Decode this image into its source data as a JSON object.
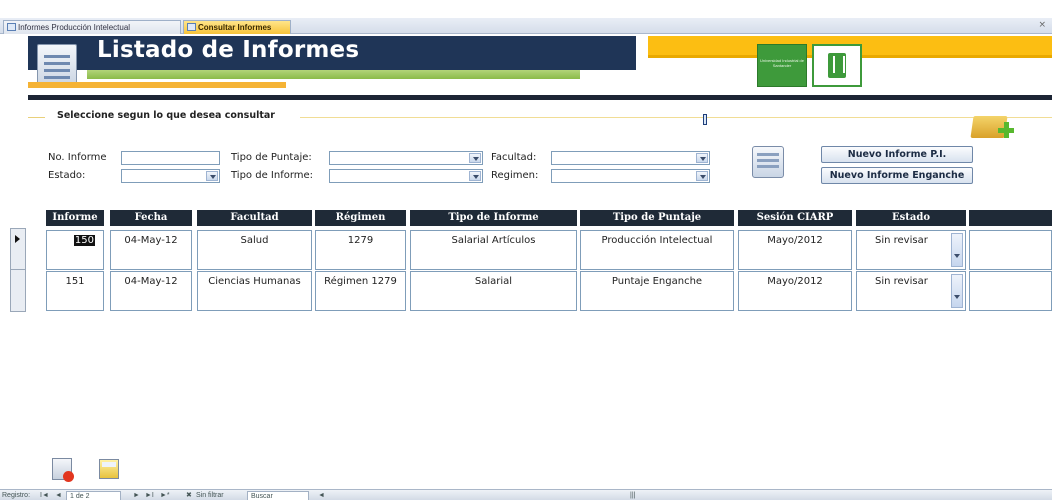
{
  "tabs": [
    {
      "label": "Informes Producción Intelectual"
    },
    {
      "label": "Consultar Informes"
    }
  ],
  "tab_close": "×",
  "header": {
    "title": "Listado de Informes",
    "logo_text": "Universidad Industrial de Santander"
  },
  "section_label": "Seleccione segun lo que desea consultar",
  "filters": {
    "no_informe": {
      "label": "No. Informe",
      "value": ""
    },
    "estado": {
      "label": "Estado:",
      "value": ""
    },
    "tipo_puntaje": {
      "label": "Tipo de Puntaje:",
      "value": ""
    },
    "tipo_informe": {
      "label": "Tipo de Informe:",
      "value": ""
    },
    "facultad": {
      "label": "Facultad:",
      "value": ""
    },
    "regimen": {
      "label": "Regimen:",
      "value": ""
    }
  },
  "buttons": {
    "nuevo_pi": "Nuevo Informe P.I.",
    "nuevo_enganche": "Nuevo Informe Enganche"
  },
  "grid": {
    "columns": [
      "Informe",
      "Fecha",
      "Facultad",
      "Régimen",
      "Tipo de Informe",
      "Tipo de Puntaje",
      "Sesión CIARP",
      "Estado"
    ],
    "rows": [
      {
        "informe": "150",
        "fecha": "04-May-12",
        "facultad": "Salud",
        "regimen": "1279",
        "tipo_informe": "Salarial Artículos",
        "tipo_puntaje": "Producción Intelectual",
        "sesion": "Mayo/2012",
        "estado": "Sin revisar"
      },
      {
        "informe": "151",
        "fecha": "04-May-12",
        "facultad": "Ciencias Humanas",
        "regimen": "Régimen 1279",
        "tipo_informe": "Salarial",
        "tipo_puntaje": "Puntaje Enganche",
        "sesion": "Mayo/2012",
        "estado": "Sin revisar"
      }
    ]
  },
  "navigation": {
    "registro_label": "Registro:",
    "first": "I◄",
    "prev": "◄",
    "position": "1 de 2",
    "next": "►",
    "last": "►I",
    "new": "►*",
    "filter_state": "Sin filtrar",
    "search_placeholder": "Buscar"
  },
  "icons": [
    "form-icon",
    "calculator-icon",
    "folder-add-icon",
    "close-form-icon",
    "report-icon"
  ],
  "colors": {
    "banner": "#1f3557",
    "accent_gold": "#fcbe12",
    "accent_green": "#8bbb4a",
    "header_dark": "#1f2a37"
  }
}
